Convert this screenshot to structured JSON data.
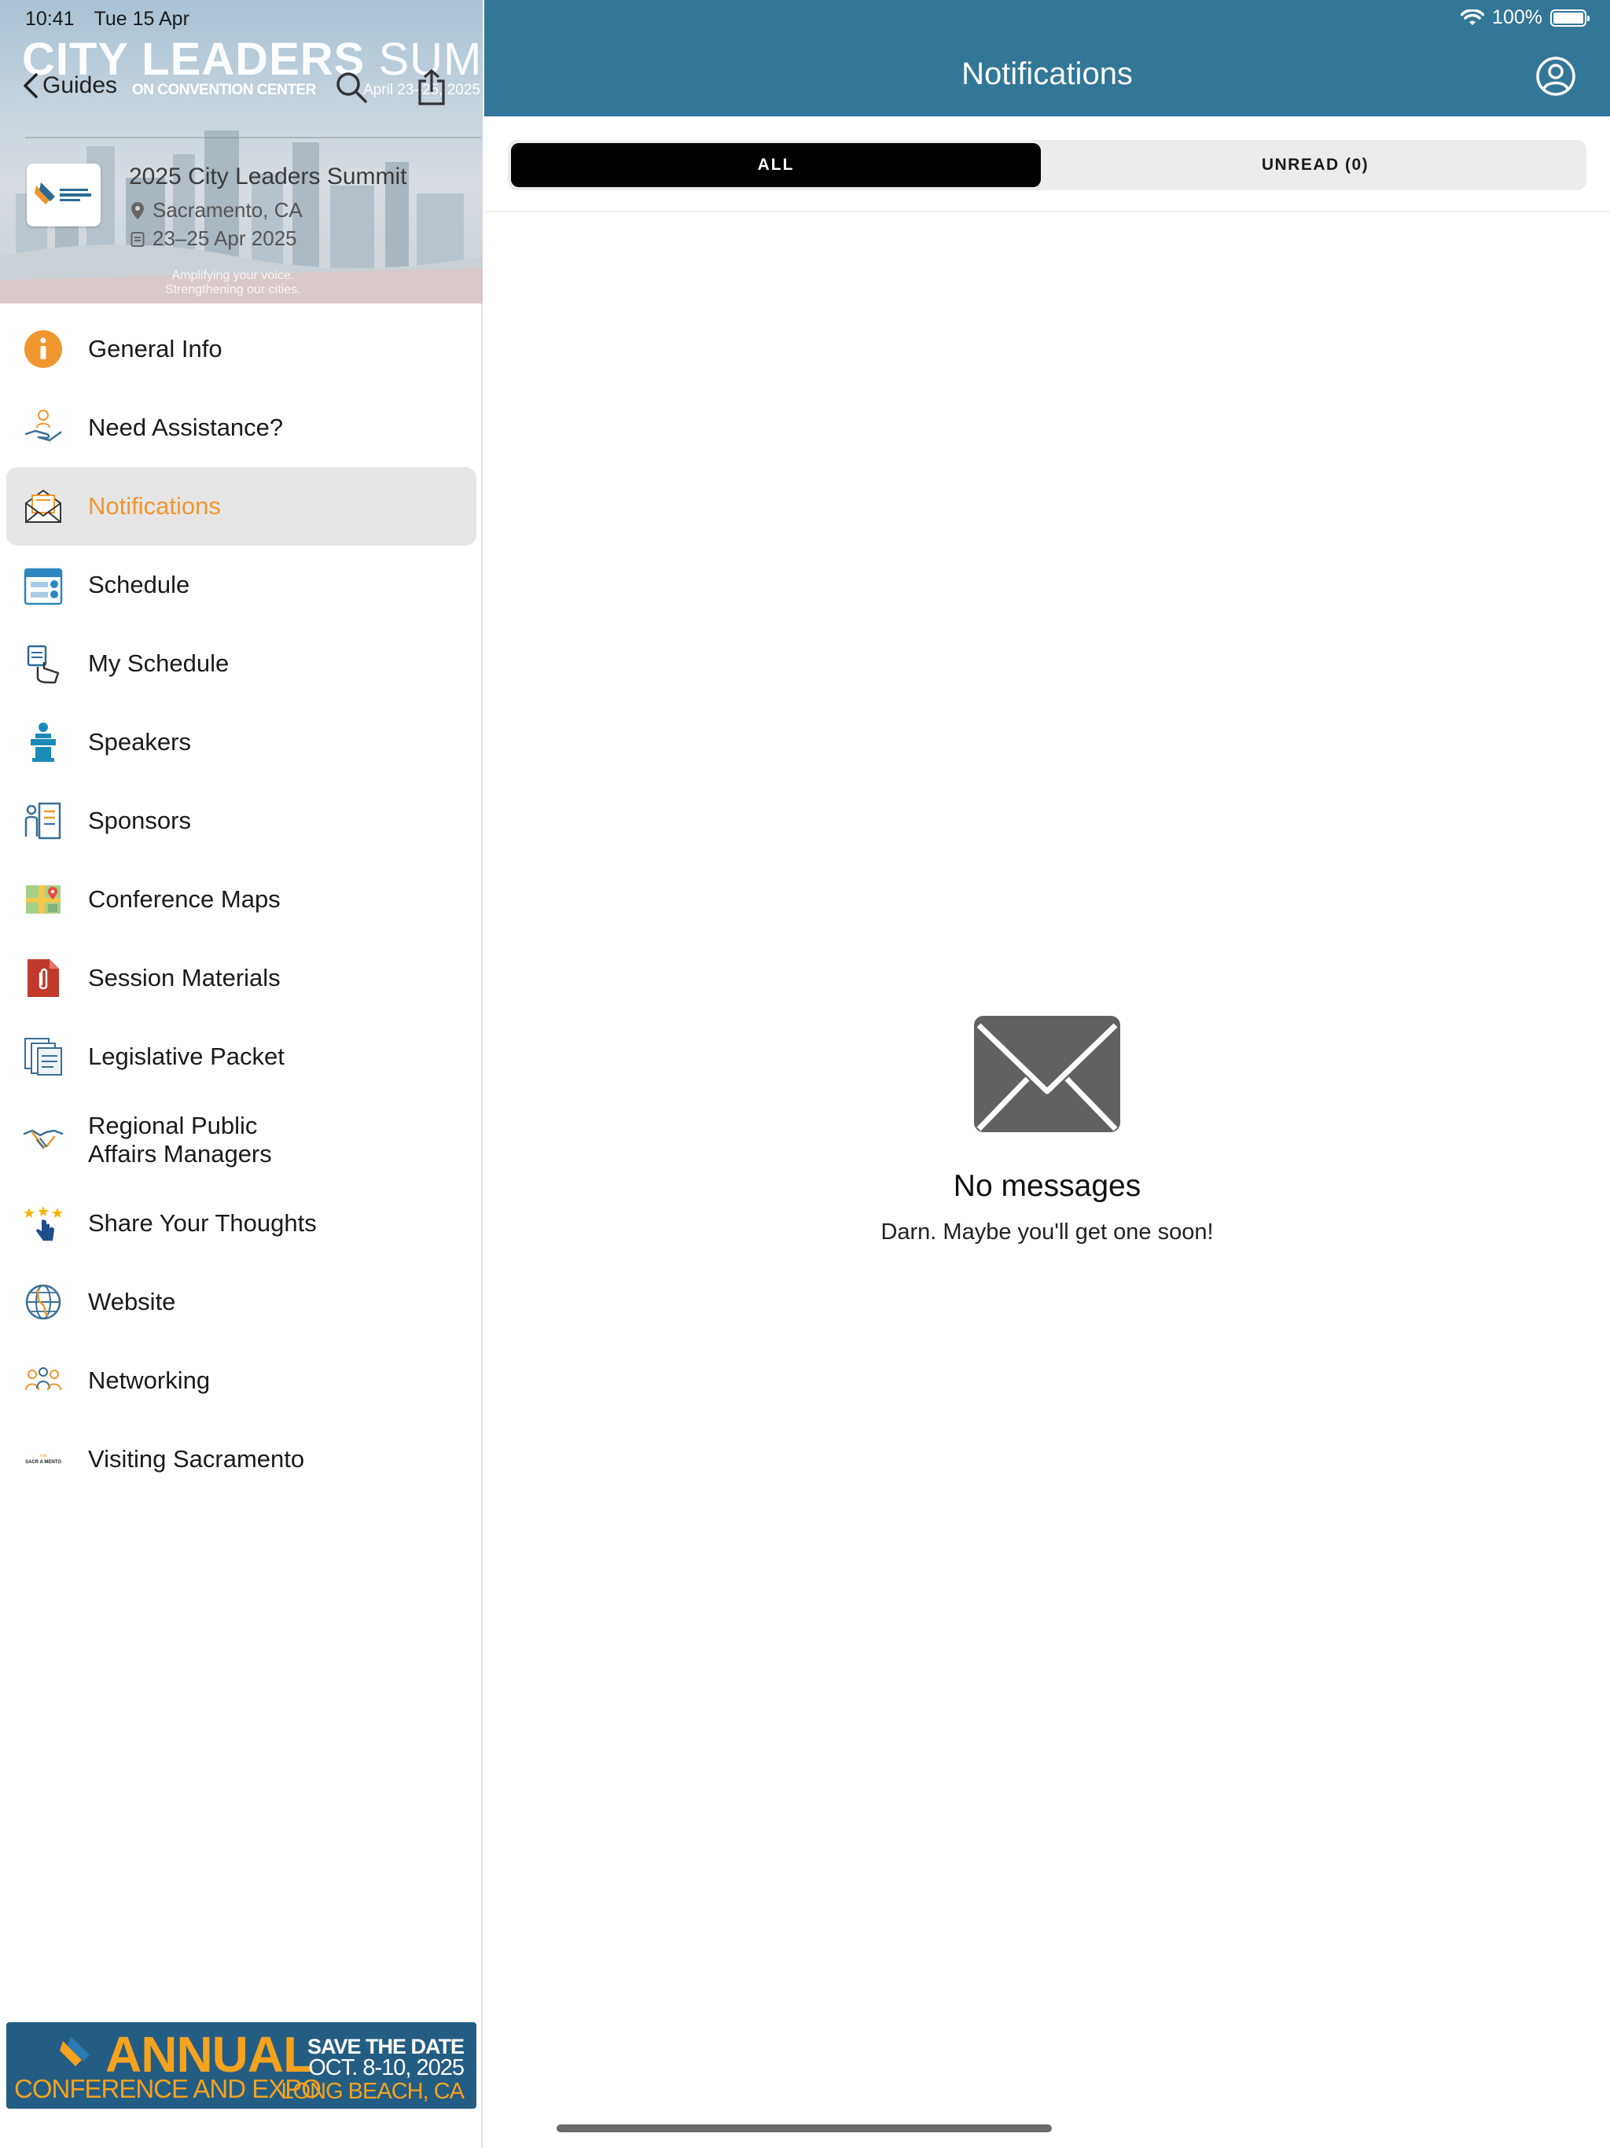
{
  "status_bar": {
    "time": "10:41",
    "date": "Tue 15 Apr",
    "battery": "100%"
  },
  "sidebar": {
    "hero": {
      "title_bold": "CITY LEADERS",
      "title_light": "SUMMIT",
      "subtitle": "ON CONVENTION CENTER",
      "date_overlay": "April 23–25, 2025",
      "back_label": "Guides",
      "event_name": "2025 City Leaders Summit",
      "location": "Sacramento, CA",
      "dates": "23–25 Apr 2025",
      "tagline_1": "Amplifying your voice.",
      "tagline_2": "Strengthening our cities."
    },
    "items": [
      {
        "label": "General Info",
        "icon": "info-icon"
      },
      {
        "label": "Need Assistance?",
        "icon": "helping-hand-icon"
      },
      {
        "label": "Notifications",
        "icon": "envelope-icon",
        "active": true
      },
      {
        "label": "Schedule",
        "icon": "calendar-icon"
      },
      {
        "label": "My Schedule",
        "icon": "my-schedule-icon"
      },
      {
        "label": "Speakers",
        "icon": "podium-icon"
      },
      {
        "label": "Sponsors",
        "icon": "sponsors-icon"
      },
      {
        "label": "Conference Maps",
        "icon": "map-icon"
      },
      {
        "label": "Session Materials",
        "icon": "document-attachment-icon"
      },
      {
        "label": "Legislative Packet",
        "icon": "papers-icon"
      },
      {
        "label_line1": "Regional Public",
        "label_line2": "Affairs Managers",
        "icon": "handshake-icon"
      },
      {
        "label": "Share Your Thoughts",
        "icon": "star-rating-icon"
      },
      {
        "label": "Website",
        "icon": "globe-icon"
      },
      {
        "label": "Networking",
        "icon": "people-icon"
      },
      {
        "label": "Visiting Sacramento",
        "icon": "visit-sacramento-logo"
      }
    ],
    "banner": {
      "headline": "ANNUAL",
      "subline": "CONFERENCE AND EXPO",
      "save_the_date": "SAVE THE DATE",
      "dates": "OCT. 8-10, 2025",
      "location": "LONG BEACH, CA"
    }
  },
  "main": {
    "title": "Notifications",
    "tabs": {
      "all": "ALL",
      "unread": "UNREAD (0)"
    },
    "empty_state": {
      "title": "No messages",
      "subtitle": "Darn. Maybe you'll get one soon!"
    }
  },
  "colors": {
    "header": "#327698",
    "accent": "#f0962e",
    "active_bg": "#e6e6e6",
    "banner_bg": "#245d84",
    "banner_accent": "#f5a21e"
  }
}
